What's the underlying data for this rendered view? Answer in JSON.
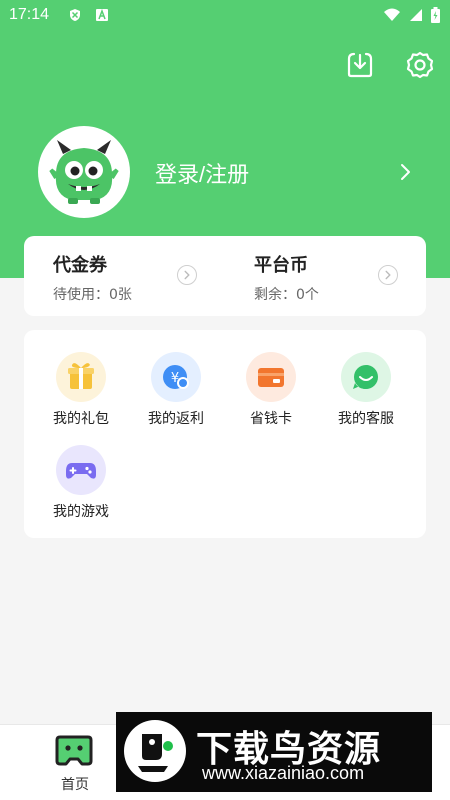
{
  "status_bar": {
    "time": "17:14"
  },
  "profile": {
    "login_label": "登录/注册"
  },
  "wallet": {
    "items": [
      {
        "title": "代金券",
        "subtitle": "待使用：0张"
      },
      {
        "title": "平台币",
        "subtitle": "剩余：0个"
      }
    ]
  },
  "services": {
    "items": [
      {
        "label": "我的礼包",
        "icon": "gift-icon",
        "color": "#f6c23a"
      },
      {
        "label": "我的返利",
        "icon": "rebate-icon",
        "color": "#3f8ef5"
      },
      {
        "label": "省钱卡",
        "icon": "card-icon",
        "color": "#f2762e"
      },
      {
        "label": "我的客服",
        "icon": "chat-icon",
        "color": "#33c069"
      },
      {
        "label": "我的游戏",
        "icon": "gamepad-icon",
        "color": "#7a6cf0"
      }
    ]
  },
  "bottom_nav": {
    "home_label": "首页"
  },
  "watermark": {
    "title": "下载鸟资源",
    "url": "www.xiazainiao.com"
  },
  "theme": {
    "accent": "#55cf72"
  }
}
